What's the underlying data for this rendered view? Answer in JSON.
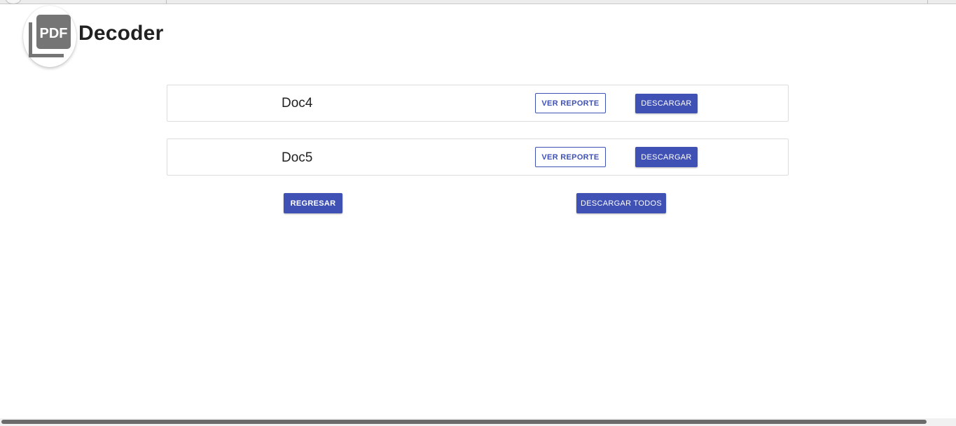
{
  "header": {
    "logo_icon": "pdf-stack-icon",
    "logo_text": "PDF",
    "title": "Decoder"
  },
  "documents": [
    {
      "name": "Doc4",
      "view_label": "VER REPORTE",
      "download_label": "DESCARGAR"
    },
    {
      "name": "Doc5",
      "view_label": "VER REPORTE",
      "download_label": "DESCARGAR"
    }
  ],
  "actions": {
    "back_label": "REGRESAR",
    "download_all_label": "DESCARGAR TODOS"
  },
  "colors": {
    "primary": "#3f51b5",
    "logo_gray": "#757575",
    "text": "#212121"
  }
}
